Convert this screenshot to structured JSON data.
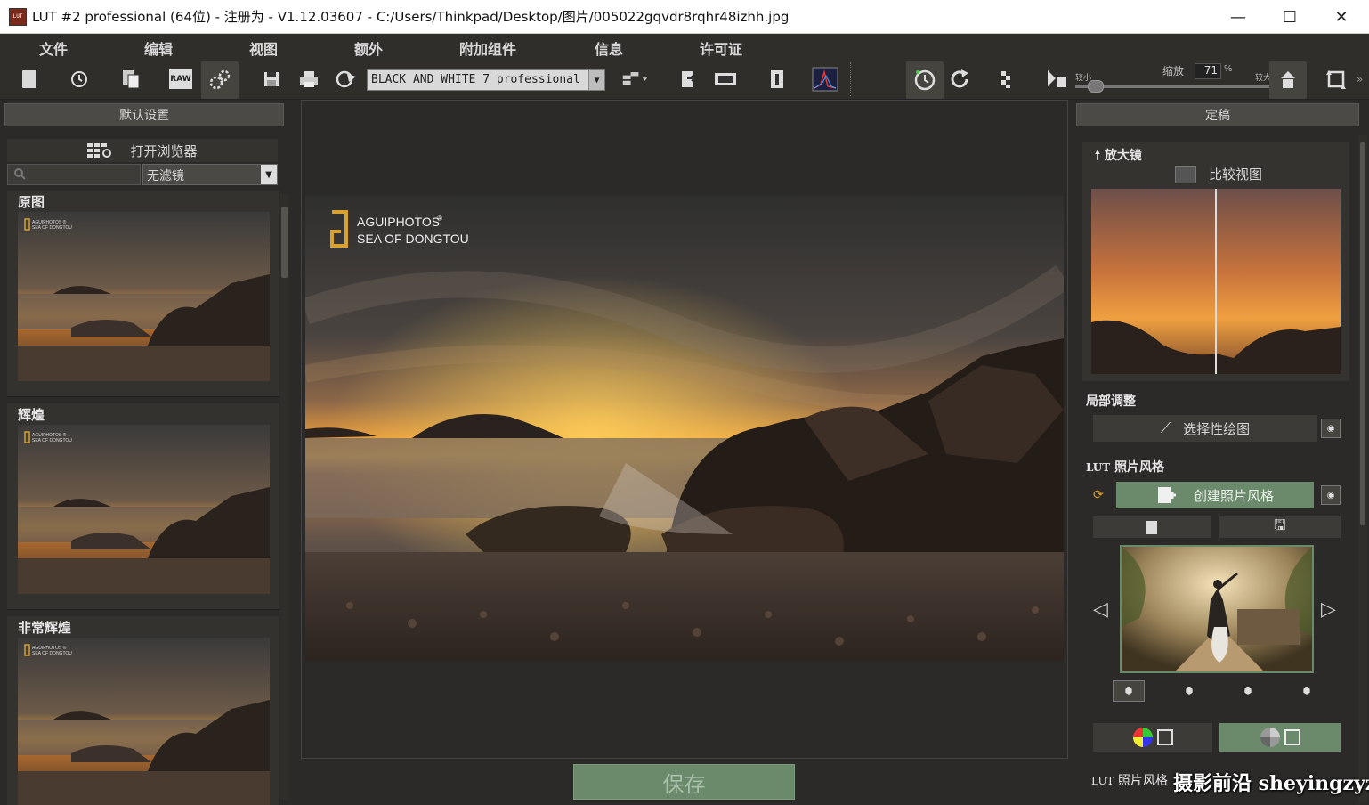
{
  "window": {
    "title": "LUT #2 professional (64位) - 注册为 - V1.12.03607 - C:/Users/Thinkpad/Desktop/图片/005022gqvdr8rqhr48izhh.jpg",
    "app_icon_text": "LUT",
    "minimize": "—",
    "maximize": "☐",
    "close": "✕"
  },
  "menu": {
    "file": "文件",
    "edit": "编辑",
    "view": "视图",
    "extra": "额外",
    "addons": "附加组件",
    "info": "信息",
    "license": "许可证"
  },
  "toolbar": {
    "preset": "BLACK AND WHITE 7 professional",
    "raw_label": "RAW",
    "zoom_label": "缩放",
    "zoom_value": "71",
    "zoom_unit": "%",
    "zoom_min": "较小",
    "zoom_max": "较大",
    "zoom_level": 0.71
  },
  "left": {
    "header": "默认设置",
    "open_browser": "打开浏览器",
    "search_placeholder": "",
    "filter": "无滤镜",
    "thumbs": [
      {
        "label": "原图"
      },
      {
        "label": "辉煌"
      },
      {
        "label": "非常辉煌"
      }
    ],
    "watermark_line1": "AGUIPHOTOS ®",
    "watermark_line2": "SEA OF DONGTOU"
  },
  "main": {
    "logo_line1": "AGUIPHOTOS",
    "logo_reg": "®",
    "logo_line2": "SEA OF DONGTOU",
    "save": "保存"
  },
  "right": {
    "header": "定稿",
    "magnifier": "放大镜",
    "compare": "比较视图",
    "local_adjust": "局部调整",
    "selective_paint": "选择性绘图",
    "lut_style_prefix": "LUT",
    "lut_style": "照片风格",
    "create_style": "创建照片风格",
    "lut_style_bottom": "照片风格",
    "lut_bottom_prefix": "LUT"
  },
  "overlay": {
    "site": "摄影前沿 sheyingzyz.com"
  },
  "colors": {
    "accent_green": "#6b8a6c",
    "panel_bg": "#2b2a28"
  }
}
